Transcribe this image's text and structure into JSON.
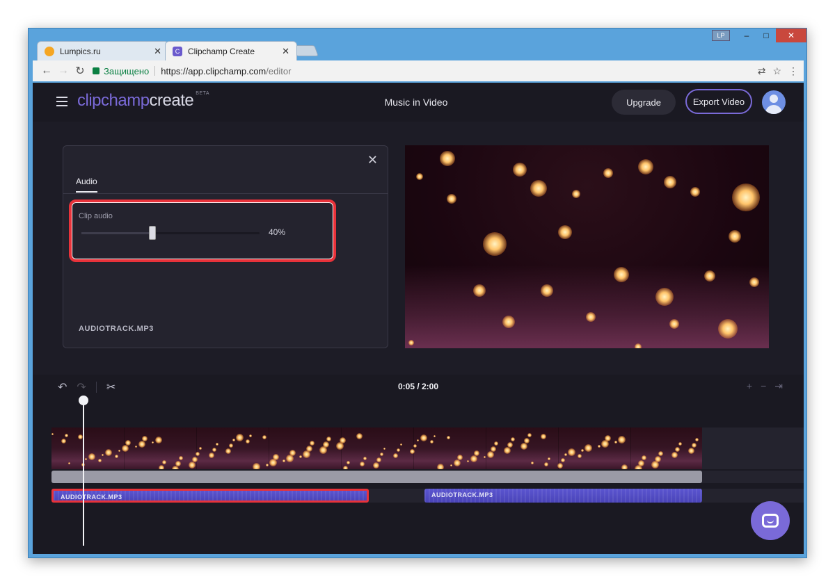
{
  "browser": {
    "tabs": [
      {
        "title": "Lumpics.ru",
        "favicon_color": "#f5a623"
      },
      {
        "title": "Clipchamp Create",
        "favicon_color": "#6a5acd"
      }
    ],
    "profile_badge": "LP",
    "address": {
      "secure_label": "Защищено",
      "url_host": "https://app.clipchamp.com",
      "url_path": "/editor"
    }
  },
  "app": {
    "brand_part1": "clipchamp",
    "brand_part2": "create",
    "brand_tag": "BETA",
    "project_title": "Music in Video",
    "upgrade_label": "Upgrade",
    "export_label": "Export Video",
    "accent_color": "#7a6ad8"
  },
  "audio_panel": {
    "tab_label": "Audio",
    "clip_audio_label": "Clip audio",
    "volume_value": "40%",
    "volume_fraction": 0.4,
    "file_name": "AUDIOTRACK.MP3"
  },
  "timeline": {
    "timecode": "0:05 / 2:00",
    "audio_clips": [
      {
        "label": "AUDIOTRACK.MP3",
        "selected": true
      },
      {
        "label": "AUDIOTRACK.MP3",
        "selected": false
      }
    ]
  },
  "icons": [
    "menu-icon",
    "close-icon",
    "undo-icon",
    "redo-icon",
    "scissors-icon",
    "zoom-in-icon",
    "zoom-out-icon",
    "fit-icon",
    "chat-icon",
    "translate-icon",
    "star-icon",
    "more-icon"
  ],
  "highlight_color": "#e8323a"
}
